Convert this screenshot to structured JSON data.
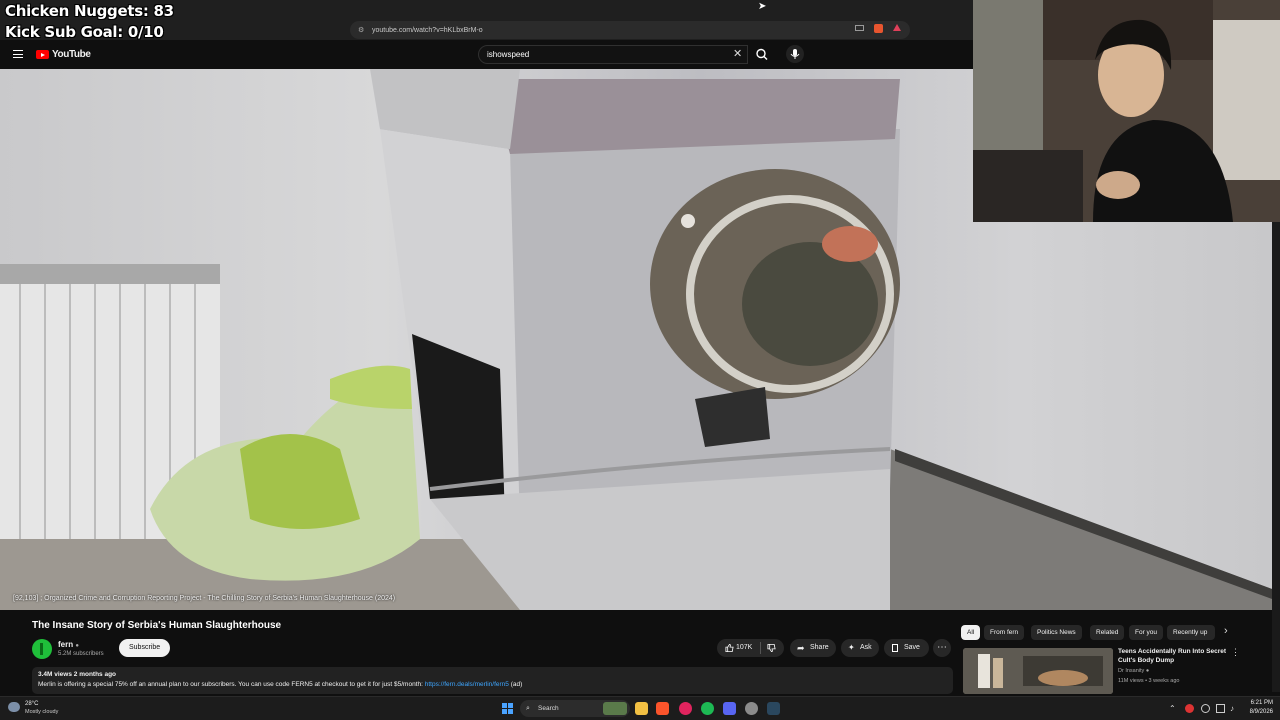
{
  "overlay": {
    "nuggets": "Chicken Nuggets: 83",
    "sub_goal": "Kick Sub Goal: 0/10"
  },
  "browser": {
    "url": "youtube.com/watch?v=hKLbxBrM-o"
  },
  "youtube": {
    "logo": "YouTube",
    "search_value": "ishowspeed"
  },
  "video": {
    "caption": "[92,103] ; Organized Crime and Corruption Reporting Project - The Chilling Story of Serbia's Human Slaughterhouse (2024)",
    "title": "The Insane Story of Serbia's Human Slaughterhouse",
    "channel": "fern",
    "subscribers": "5.2M subscribers",
    "subscribe_label": "Subscribe",
    "likes": "107K",
    "share_label": "Share",
    "ask_label": "Ask",
    "save_label": "Save",
    "views_date": "3.4M views  2 months ago",
    "description": "Merlin is offering a special 75% off an annual plan to our subscribers. You can use code FERN5 at checkout to get it for just $5/month: ",
    "description_link": "https://fern.deals/merlin/fern5",
    "description_suffix": " (ad)"
  },
  "chips": [
    "All",
    "From fern",
    "Politics News",
    "Related",
    "For you",
    "Recently up"
  ],
  "recommendation": {
    "title": "Teens Accidentally Run Into Secret Cult's Body Dump",
    "channel": "Dr Insanity",
    "stats": "11M views • 3 weeks ago"
  },
  "taskbar": {
    "temp": "28°C",
    "condition": "Mostly cloudy",
    "search_label": "Search",
    "time": "6:21 PM",
    "date": "8/9/2026"
  },
  "colors": {
    "yt_red": "#ff0000",
    "link_blue": "#3ea6ff",
    "background": "#0f0f0f"
  }
}
